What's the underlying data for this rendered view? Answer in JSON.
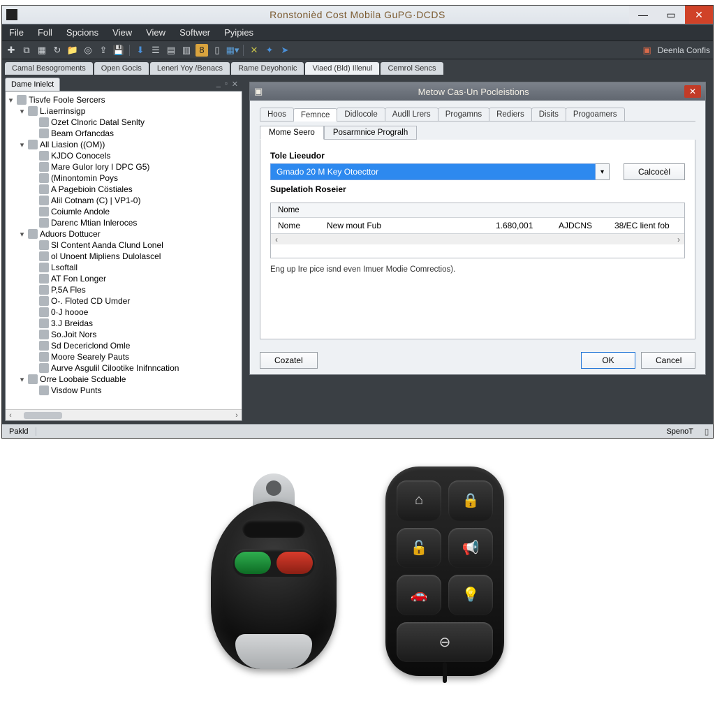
{
  "titlebar": {
    "title": "Ronstonièd Cost Mobila GuPG·DCDS"
  },
  "menubar": [
    "File",
    "Foll",
    "Spcions",
    "View",
    "View",
    "Softwer",
    "Pyipies"
  ],
  "toolbar_right": "Deenla Confis",
  "doctabs": [
    {
      "label": "Camal Besogroments",
      "active": false
    },
    {
      "label": "Open Gocis",
      "active": false
    },
    {
      "label": "Leneri Yoy /Benacs",
      "active": false
    },
    {
      "label": "Rame Deyohonic",
      "active": false
    },
    {
      "label": "Viaed (Bld) Illenul",
      "active": true
    },
    {
      "label": "Cemrol Sencs",
      "active": false
    }
  ],
  "left_pane": {
    "tab": "Dame Inielct",
    "root": "Tisvfe Foole Sercers",
    "branches": [
      {
        "label": "L.iaerrinsigp",
        "children": [
          "Ozet Clnoric Datal Senlty",
          "Beam Orfancdas"
        ]
      },
      {
        "label": "All Liasion ((OM))",
        "children": [
          "KJDO Conocels",
          "Mare Gulor lory I DPC G5)",
          "(Minontomin Poys",
          "A Pagebioin Cöstiales",
          "Alil Cotnam (C) | VP1-0)",
          "Coiumle Andole",
          "Darenc Mtian Inleroces"
        ]
      },
      {
        "label": "Aduors Dottucer",
        "children": [
          "Sl Content Aanda Clund Lonel",
          "ol Unoent Mipliens Dulolascel",
          "Lsoftall",
          "AT Fon Longer",
          "P,5A Fles",
          "O-. Floted CD Umder",
          "0·J hoooe",
          "3.J Breidas",
          "So.Joit Nors",
          "Sd Decericlond Omle",
          "Moore Searely Pauts",
          "Aurve Asgulil Cilootike Inifnncation"
        ]
      },
      {
        "label": "Orre Loobaie Scduable",
        "children": [
          "Visdow Punts"
        ]
      }
    ]
  },
  "dialog": {
    "title": "Metow Cas·Un Pocleistions",
    "tabs": [
      "Hoos",
      "Femnce",
      "Didlocole",
      "Audll Lrers",
      "Progamns",
      "Rediers",
      "Disits",
      "Progoamers"
    ],
    "active_tab": 1,
    "subtabs": [
      "Mome Seero",
      "Posarmnice Progralh"
    ],
    "active_subtab": 0,
    "field_label": "Tole Lieeudor",
    "combo_value": "Gmado 20 M Key Otoecttor",
    "calc_btn": "Calcocèl",
    "section_label": "Supelatioh Roseier",
    "columns": [
      "Nome",
      "",
      "",
      "",
      ""
    ],
    "row": [
      "Nome",
      "New mout Fub",
      "1.680,001",
      "AJDCNS",
      "38/EC lient fob"
    ],
    "hint": "Eng up Ire pice isnd even Imuer Modie Comrectios).",
    "buttons": {
      "cozel": "Cozatel",
      "ok": "OK",
      "cancel": "Cancel"
    }
  },
  "statusbar": {
    "left": "Pakld",
    "right": "SpenoT"
  },
  "fob_icons": {
    "lock": "🔒",
    "unlock": "🔓",
    "home": "⌂",
    "horn": "📢",
    "trunk": "🚗",
    "light": "💡",
    "panic": "⊖"
  }
}
